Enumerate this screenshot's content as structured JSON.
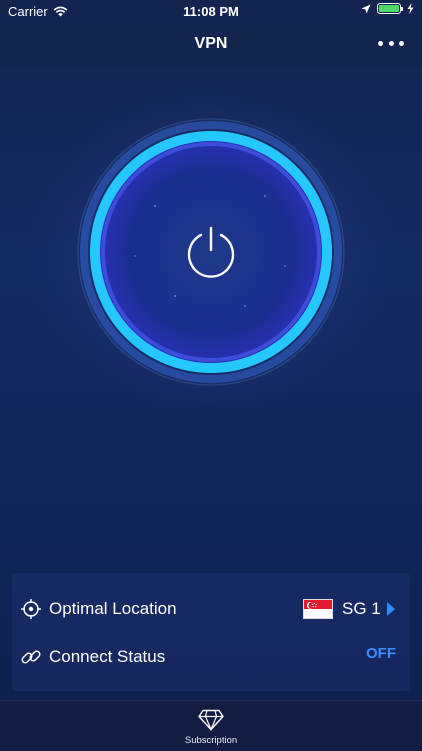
{
  "status_bar": {
    "carrier": "Carrier",
    "time": "11:08 PM",
    "icons": [
      "wifi-icon",
      "location-arrow-icon",
      "battery-icon",
      "charging-bolt-icon"
    ]
  },
  "nav": {
    "title": "VPN",
    "more_icon": "more-dots-icon"
  },
  "power": {
    "icon": "power-icon",
    "ring_color": "#24c8ff"
  },
  "info_panel": {
    "location": {
      "icon": "crosshair-icon",
      "label": "Optimal Location",
      "flag": "singapore-flag",
      "server": "SG 1"
    },
    "status": {
      "icon": "link-icon",
      "label": "Connect Status",
      "value": "OFF",
      "value_color": "#3a8dff"
    }
  },
  "tab_bar": {
    "items": [
      {
        "icon": "diamond-icon",
        "label": "Subscription"
      }
    ]
  },
  "colors": {
    "background": "#13244f",
    "accent": "#2f8cff"
  }
}
